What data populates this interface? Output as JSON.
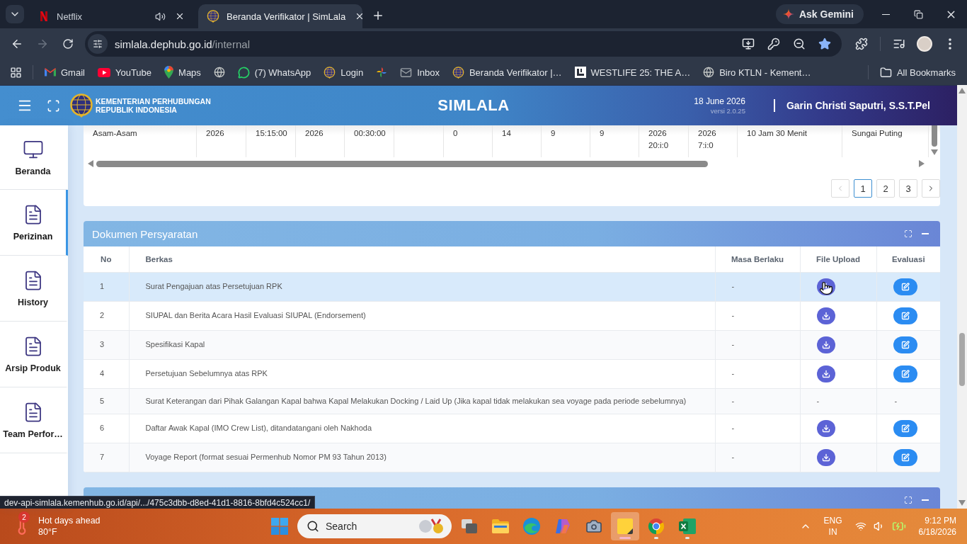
{
  "browser": {
    "tabs": [
      {
        "title": "Netflix",
        "kind": "netflix",
        "audio": true,
        "selected": false
      },
      {
        "title": "Beranda Verifikator | SimLala",
        "kind": "site",
        "audio": false,
        "selected": true
      }
    ],
    "assistant_button": "Ask Gemini",
    "forward_disabled": true,
    "address": {
      "host": "simlala.dephub.go.id",
      "path": "/internal"
    },
    "bookmarked": true,
    "bookmarks": [
      {
        "label": "Gmail",
        "kind": "mail"
      },
      {
        "label": "YouTube",
        "kind": "video"
      },
      {
        "label": "Maps",
        "kind": "maps"
      },
      {
        "kind": "globe"
      },
      {
        "label": "(7) WhatsApp",
        "kind": "chat"
      },
      {
        "label": "Login",
        "kind": "site"
      },
      {
        "kind": "pinwheel"
      },
      {
        "label": "Inbox",
        "kind": "envelope"
      },
      {
        "label": "Beranda Verifikator |…",
        "kind": "site"
      },
      {
        "label": "WESTLIFE 25: THE A…",
        "kind": "square"
      },
      {
        "label": "Biro KTLN - Kement…",
        "kind": "globe"
      }
    ],
    "all_bookmarks": "All Bookmarks",
    "status_url": "dev-api-simlala.kemenhub.go.id/api/.../475c3dbb-d8ed-41d1-8816-8bfd4c524cc1/"
  },
  "app_header": {
    "org": [
      "KEMENTERIAN PERHUBUNGAN",
      "REPUBLIK INDONESIA"
    ],
    "title": "SIMLALA",
    "date": "18 June 2026",
    "version": "versi 2.0.25",
    "user": "Garin Christi Saputri, S.S.T.Pel"
  },
  "sidebar": {
    "items": [
      {
        "label": "Beranda",
        "kind": "monitor",
        "selected": false
      },
      {
        "label": "Perizinan",
        "kind": "document",
        "selected": true
      },
      {
        "label": "History",
        "kind": "document",
        "selected": false
      },
      {
        "label": "Arsip Produk",
        "kind": "document",
        "selected": false
      },
      {
        "label": "Team Perfor…",
        "kind": "document",
        "selected": false
      }
    ]
  },
  "schedule_table": {
    "cells": [
      "Asam-Asam",
      "2026",
      "15:15:00",
      "2026",
      "00:30:00",
      null,
      "0",
      "14",
      "9",
      "9",
      "2026\n20:i:0",
      "2026\n7:i:0",
      "10 Jam 30 Menit",
      "Sungai Puting"
    ]
  },
  "pagination": {
    "previous_disabled": true,
    "pages": [
      {
        "label": "1",
        "selected": true
      },
      {
        "label": "2",
        "selected": false
      },
      {
        "label": "3",
        "selected": false
      }
    ]
  },
  "documents": {
    "title": "Dokumen Persyaratan",
    "columns": [
      "No",
      "Berkas",
      "Masa Berlaku",
      "File Upload",
      "Evaluasi"
    ],
    "rows": [
      {
        "no": "1",
        "name": "Surat Pengajuan atas Persetujuan RPK",
        "validity": "-",
        "kind": "uploaded",
        "selected": true
      },
      {
        "no": "2",
        "name": "SIUPAL dan Berita Acara Hasil Evaluasi SIUPAL (Endorsement)",
        "validity": "-",
        "kind": "uploaded",
        "selected": false
      },
      {
        "no": "3",
        "name": "Spesifikasi Kapal",
        "validity": "-",
        "kind": "uploaded",
        "selected": false
      },
      {
        "no": "4",
        "name": "Persetujuan Sebelumnya atas RPK",
        "validity": "-",
        "kind": "uploaded",
        "selected": false
      },
      {
        "no": "5",
        "name": "Surat Keterangan dari Pihak Galangan Kapal bahwa Kapal Melakukan Docking / Laid Up (Jika kapal tidak melakukan sea voyage pada periode sebelumnya)",
        "validity": "-",
        "kind": "missing",
        "file_upload": "-",
        "evaluation": "-",
        "selected": false
      },
      {
        "no": "6",
        "name": "Daftar Awak Kapal (IMO Crew List), ditandatangani oleh Nakhoda",
        "validity": "-",
        "kind": "uploaded",
        "selected": false
      },
      {
        "no": "7",
        "name": "Voyage Report (format sesuai Permenhub Nomor PM 93 Tahun 2013)",
        "validity": "-",
        "kind": "uploaded",
        "selected": false
      }
    ]
  },
  "taskbar": {
    "weather": {
      "badge": "2",
      "title": "Hot days ahead",
      "temperature": "80°F"
    },
    "search_placeholder": "Search",
    "apps": [
      {
        "kind": "task-view",
        "running": false,
        "selected": false
      },
      {
        "kind": "folder",
        "running": false,
        "selected": false
      },
      {
        "kind": "edge",
        "running": false,
        "selected": false
      },
      {
        "kind": "copilot",
        "running": false,
        "selected": false
      },
      {
        "kind": "camera",
        "running": false,
        "selected": false
      },
      {
        "kind": "notes",
        "running": true,
        "selected": true
      },
      {
        "kind": "chrome",
        "running": true,
        "selected": false
      },
      {
        "kind": "spreadsheet",
        "running": true,
        "selected": false
      }
    ],
    "language": [
      "ENG",
      "IN"
    ],
    "time": "9:12 PM",
    "date": "6/18/2026"
  }
}
